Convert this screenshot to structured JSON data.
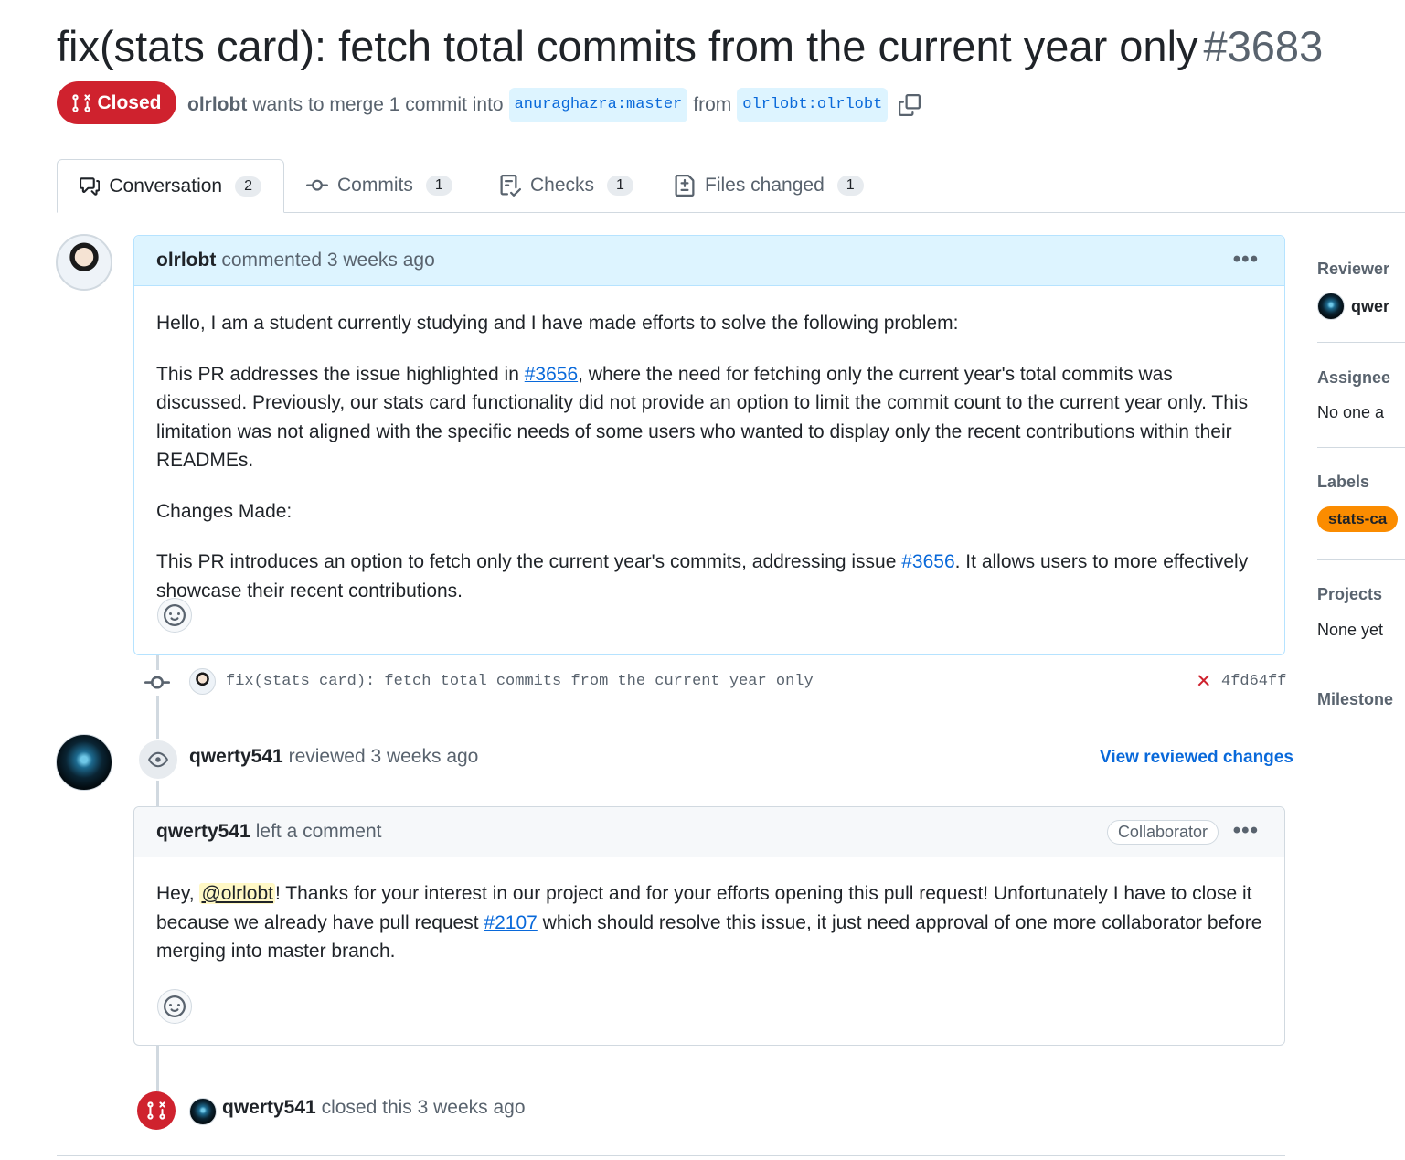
{
  "pr": {
    "title": "fix(stats card): fetch total commits from the current year only",
    "number": "#3683",
    "state": "Closed",
    "author": "olrlobt",
    "merge_text": "wants to merge 1 commit into",
    "base_branch": "anuraghazra:master",
    "from_text": "from",
    "head_branch": "olrlobt:olrlobt"
  },
  "tabs": [
    {
      "label": "Conversation",
      "count": "2"
    },
    {
      "label": "Commits",
      "count": "1"
    },
    {
      "label": "Checks",
      "count": "1"
    },
    {
      "label": "Files changed",
      "count": "1"
    }
  ],
  "comment1": {
    "author": "olrlobt",
    "action": "commented 3 weeks ago",
    "p1": "Hello, I am a student currently studying and I have made efforts to solve the following problem:",
    "p2_before": "This PR addresses the issue highlighted in ",
    "p2_link": "#3656",
    "p2_after": ", where the need for fetching only the current year's total commits was discussed. Previously, our stats card functionality did not provide an option to limit the commit count to the current year only. This limitation was not aligned with the specific needs of some users who wanted to display only the recent contributions within their READMEs.",
    "p3": "Changes Made:",
    "p4_before": "This PR introduces an option to fetch only the current year's commits, addressing issue ",
    "p4_link": "#3656",
    "p4_after": ". It allows users to more effectively showcase their recent contributions."
  },
  "commit": {
    "message": "fix(stats card): fetch total commits from the current year only",
    "status": "✕",
    "sha": "4fd64ff"
  },
  "review": {
    "author": "qwerty541",
    "action": "reviewed 3 weeks ago",
    "view_changes": "View reviewed changes"
  },
  "comment2": {
    "author": "qwerty541",
    "action": "left a comment",
    "role": "Collaborator",
    "greeting": "Hey, ",
    "mention": "@olrlobt",
    "text_before": "! Thanks for your interest in our project and for your efforts opening this pull request! Unfortunately I have to close it because we already have pull request ",
    "link": "#2107",
    "text_after": " which should resolve this issue, it just need approval of one more collaborator before merging into master branch."
  },
  "closed_event": {
    "author": "qwerty541",
    "action": "closed this 3 weeks ago"
  },
  "sidebar": {
    "reviewers_title": "Reviewer",
    "reviewer_name": "qwer",
    "assignees_title": "Assignee",
    "assignees_value": "No one a",
    "labels_title": "Labels",
    "label": "stats-ca",
    "label_color": "#fb8c00",
    "projects_title": "Projects",
    "projects_value": "None yet",
    "milestone_title": "Milestone"
  },
  "colors": {
    "closed": "#cf222e",
    "link": "#0969da",
    "header_blue": "#ddf4ff"
  }
}
